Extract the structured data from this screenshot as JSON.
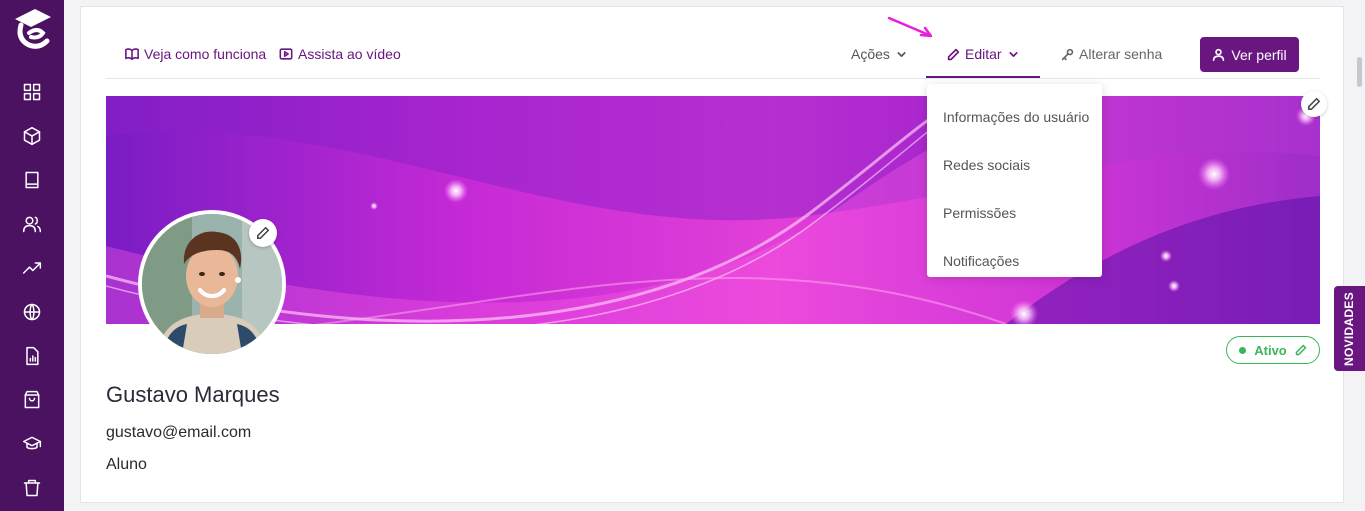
{
  "header": {
    "how_it_works": "Veja como funciona",
    "watch_video": "Assista ao vídeo",
    "actions": "Ações",
    "edit": "Editar",
    "change_password": "Alterar senha",
    "view_profile": "Ver perfil"
  },
  "edit_menu": {
    "items": [
      "Informações do usuário",
      "Redes sociais",
      "Permissões",
      "Notificações"
    ]
  },
  "profile": {
    "name": "Gustavo Marques",
    "email": "gustavo@email.com",
    "role": "Aluno",
    "status": "Ativo"
  },
  "side_tab": "NOVIDADES",
  "sidebar_icons": [
    "dashboard-icon",
    "cube-icon",
    "book-icon",
    "users-icon",
    "trending-up-icon",
    "globe-icon",
    "report-icon",
    "shopping-bag-icon",
    "graduation-cap-icon",
    "trash-icon"
  ],
  "colors": {
    "brand": "#6a1680",
    "sidebar": "#4a1261",
    "status_active": "#3bb55a",
    "annotation_arrow": "#e91edc"
  }
}
